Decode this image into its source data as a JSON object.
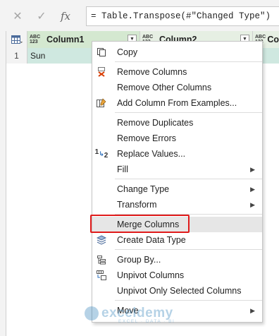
{
  "formula_bar": {
    "cancel_glyph": "✕",
    "confirm_glyph": "✓",
    "fx_label": "fx",
    "formula": "= Table.Transpose(#\"Changed Type\")"
  },
  "table": {
    "type_badge_top": "ABC",
    "type_badge_bottom": "123",
    "columns": [
      "Column1",
      "Column2",
      "Co"
    ],
    "rows": [
      {
        "num": "1",
        "value": "Sun"
      }
    ]
  },
  "context_menu": {
    "items": [
      {
        "label": "Copy",
        "icon": "copy-icon"
      },
      {
        "label": "Remove Columns",
        "icon": "remove-columns-icon"
      },
      {
        "label": "Remove Other Columns",
        "icon": ""
      },
      {
        "label": "Add Column From Examples...",
        "icon": "add-column-examples-icon"
      },
      {
        "label": "Remove Duplicates",
        "icon": ""
      },
      {
        "label": "Remove Errors",
        "icon": ""
      },
      {
        "label": "Replace Values...",
        "icon": "replace-values-icon"
      },
      {
        "label": "Fill",
        "icon": "",
        "submenu": true
      },
      {
        "label": "Change Type",
        "icon": "",
        "submenu": true
      },
      {
        "label": "Transform",
        "icon": "",
        "submenu": true
      },
      {
        "label": "Merge Columns",
        "icon": "",
        "highlighted": true
      },
      {
        "label": "Create Data Type",
        "icon": "create-data-type-icon"
      },
      {
        "label": "Group By...",
        "icon": "group-by-icon"
      },
      {
        "label": "Unpivot Columns",
        "icon": "unpivot-icon"
      },
      {
        "label": "Unpivot Only Selected Columns",
        "icon": ""
      },
      {
        "label": "Move",
        "icon": "",
        "submenu": true
      }
    ],
    "replace_values_badge": "1",
    "replace_values_badge2": "2",
    "submenu_arrow": "▶"
  },
  "watermark": {
    "title": "exceldemy",
    "subtitle": "EXCEL · DATA · BI"
  },
  "colors": {
    "selected_column_header": "#d4e8d0",
    "selected_cells": "#cfe8e0",
    "highlight_box": "#e01b1b",
    "remove_icon_red": "#d83b01"
  }
}
